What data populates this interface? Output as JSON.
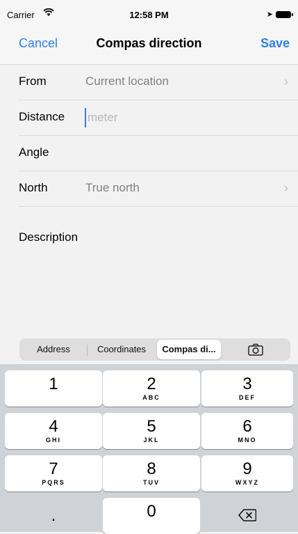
{
  "status_bar": {
    "carrier": "Carrier",
    "time": "12:58 PM"
  },
  "nav": {
    "cancel": "Cancel",
    "title": "Compas direction",
    "save": "Save"
  },
  "form": {
    "from_label": "From",
    "from_value": "Current location",
    "distance_label": "Distance",
    "distance_placeholder": "meter",
    "distance_value": "",
    "angle_label": "Angle",
    "north_label": "North",
    "north_value": "True north",
    "description_label": "Description"
  },
  "segments": [
    "Address",
    "Coordinates",
    "Compas di...",
    "camera-icon"
  ],
  "keyboard": [
    {
      "num": "1",
      "letters": ""
    },
    {
      "num": "2",
      "letters": "ABC"
    },
    {
      "num": "3",
      "letters": "DEF"
    },
    {
      "num": "4",
      "letters": "GHI"
    },
    {
      "num": "5",
      "letters": "JKL"
    },
    {
      "num": "6",
      "letters": "MNO"
    },
    {
      "num": "7",
      "letters": "PQRS"
    },
    {
      "num": "8",
      "letters": "TUV"
    },
    {
      "num": "9",
      "letters": "WXYZ"
    },
    {
      "num": ".",
      "letters": ""
    },
    {
      "num": "0",
      "letters": ""
    },
    {
      "num": "",
      "letters": ""
    }
  ],
  "colors": {
    "accent": "#2f80ed",
    "background": "#f2f2f2",
    "keyboard": "#cfd2d6"
  }
}
